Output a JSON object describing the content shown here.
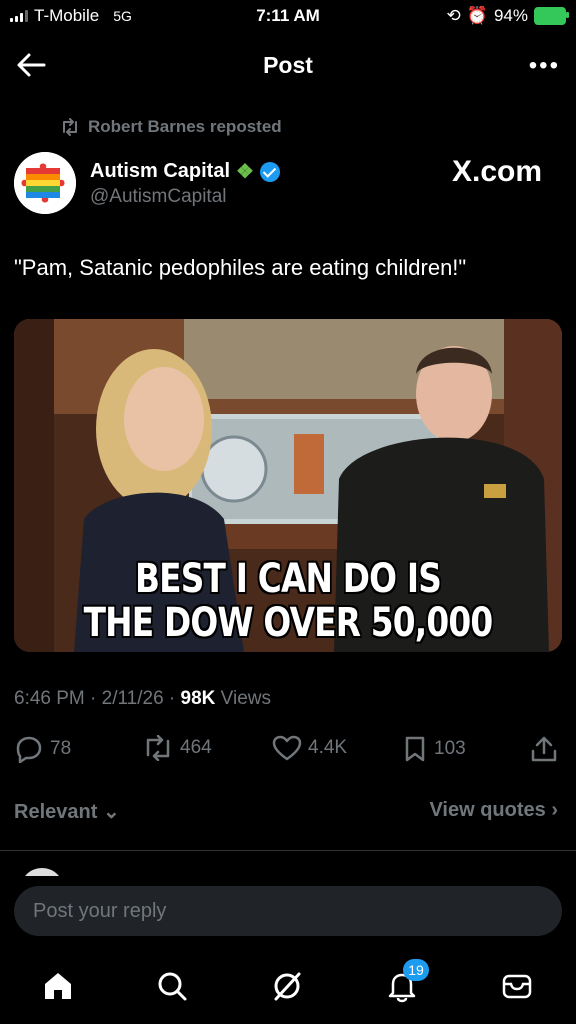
{
  "status_bar": {
    "carrier": "T-Mobile",
    "network": "5G",
    "time": "7:11 AM",
    "battery": "94%"
  },
  "header": {
    "title": "Post"
  },
  "repost": {
    "label": "Robert Barnes reposted"
  },
  "author": {
    "name": "Autism Capital",
    "handle": "@AutismCapital",
    "watermark": "X.com"
  },
  "tweet": {
    "text": "\"Pam, Satanic pedophiles are eating children!\""
  },
  "media": {
    "caption_line1": "BEST I CAN DO IS",
    "caption_line2": "THE DOW OVER 50,000"
  },
  "meta": {
    "time": "6:46 PM",
    "date": "2/11/26",
    "views_count": "98K",
    "views_label": "Views"
  },
  "actions": {
    "replies": "78",
    "reposts": "464",
    "likes": "4.4K",
    "bookmarks": "103"
  },
  "replies_filter": {
    "sort_label": "Relevant",
    "view_quotes": "View quotes"
  },
  "reply_box": {
    "placeholder": "Post your reply"
  },
  "tabbar": {
    "notifications_badge": "19"
  },
  "colors": {
    "accent": "#1d9bf0",
    "secondary_text": "#71767b",
    "background": "#000000"
  }
}
